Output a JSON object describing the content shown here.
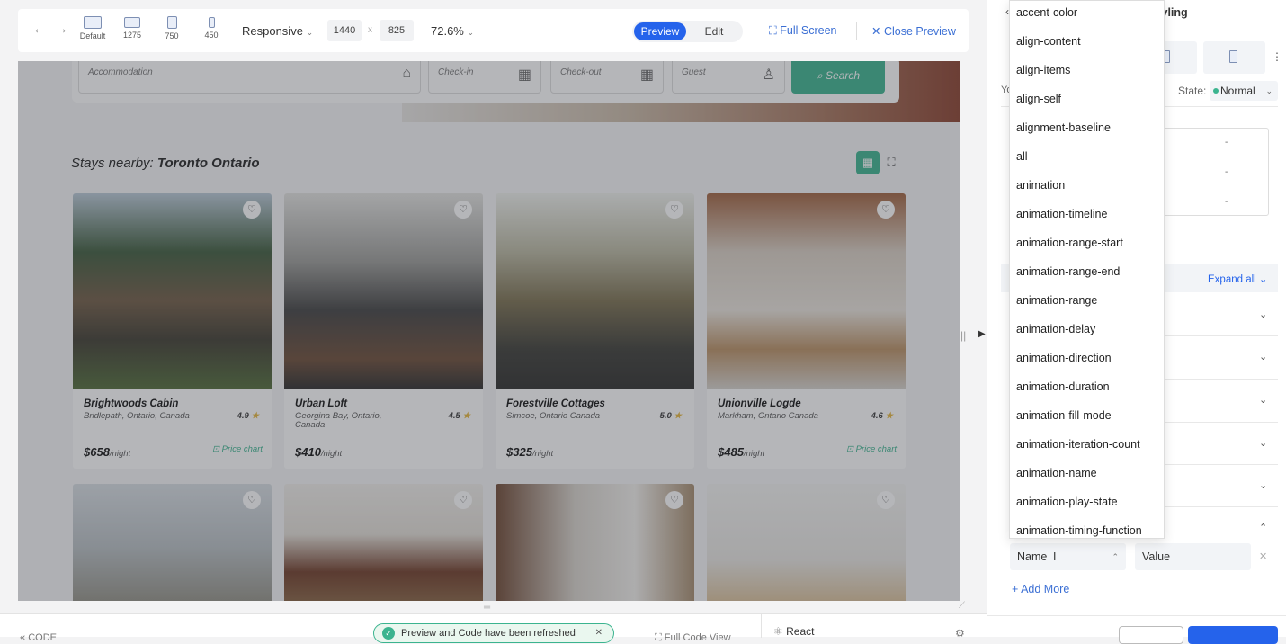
{
  "toolbar": {
    "devices": [
      {
        "label": "Default"
      },
      {
        "label": "1275"
      },
      {
        "label": "750"
      },
      {
        "label": "450"
      }
    ],
    "mode": "Responsive",
    "width": "1440",
    "x_sep": "x",
    "height": "825",
    "zoom": "72.6%",
    "preview_label": "Preview",
    "edit_label": "Edit",
    "fullscreen_label": "Full Screen",
    "close_label": "Close Preview"
  },
  "site": {
    "search": {
      "accommodation": "Accommodation",
      "checkin": "Check-in",
      "checkout": "Check-out",
      "guest": "Guest",
      "button": "Search"
    },
    "stays_prefix": "Stays nearby:",
    "stays_city": "Toronto Ontario",
    "listings": [
      {
        "name": "Brightwoods Cabin",
        "location": "Bridlepath, Ontario, Canada",
        "rating": "4.9",
        "price": "$658",
        "per": "/night",
        "chart": "Price chart"
      },
      {
        "name": "Urban Loft",
        "location": "Georgina Bay, Ontario, Canada",
        "rating": "4.5",
        "price": "$410",
        "per": "/night",
        "chart": ""
      },
      {
        "name": "Forestville Cottages",
        "location": "Simcoe, Ontario Canada",
        "rating": "5.0",
        "price": "$325",
        "per": "/night",
        "chart": ""
      },
      {
        "name": "Unionville Logde",
        "location": "Markham, Ontario Canada",
        "rating": "4.6",
        "price": "$485",
        "per": "/night",
        "chart": "Price chart"
      }
    ]
  },
  "bottom": {
    "code": "CODE",
    "toast": "Preview and Code have been refreshed",
    "fullcode": "Full Code View",
    "react": "React"
  },
  "panel": {
    "title": "Styling",
    "state_label": "State:",
    "state_value": "Normal",
    "expand_all": "Expand all",
    "name_placeholder": "Name",
    "value_placeholder": "Value",
    "add_more": "+ Add More",
    "you_fragment": "Yo"
  },
  "dropdown": [
    "accent-color",
    "align-content",
    "align-items",
    "align-self",
    "alignment-baseline",
    "all",
    "animation",
    "animation-timeline",
    "animation-range-start",
    "animation-range-end",
    "animation-range",
    "animation-delay",
    "animation-direction",
    "animation-duration",
    "animation-fill-mode",
    "animation-iteration-count",
    "animation-name",
    "animation-play-state",
    "animation-timing-function"
  ],
  "colors": {
    "accent": "#2563eb",
    "brand_green": "#3bb48f"
  }
}
